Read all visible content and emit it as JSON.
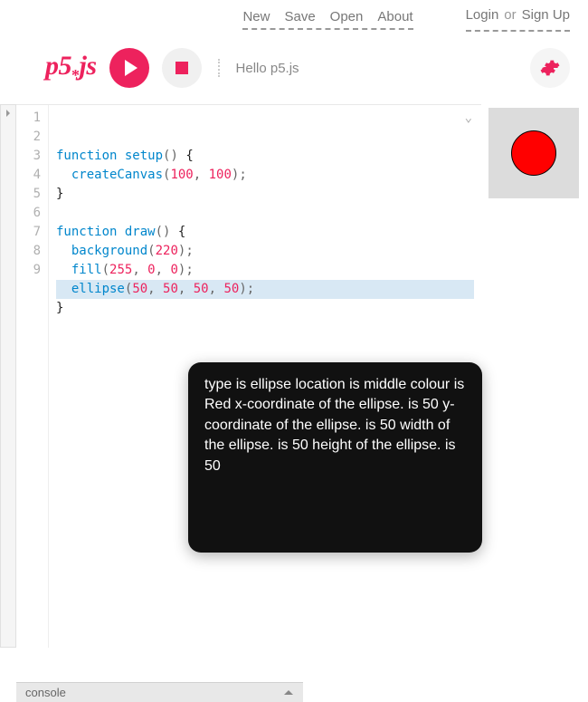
{
  "nav": {
    "new": "New",
    "save": "Save",
    "open": "Open",
    "about": "About",
    "login": "Login",
    "or": "or",
    "signup": "Sign Up"
  },
  "logo": {
    "prefix": "p5",
    "star": "*",
    "suffix": "js"
  },
  "sketch_name": "Hello p5.js",
  "code": {
    "lines": [
      1,
      2,
      3,
      4,
      5,
      6,
      7,
      8,
      9
    ],
    "l1_fn": "function",
    "l1_name": "setup",
    "l1_paren": "()",
    "l1_brace": " {",
    "l2_fn": "createCanvas",
    "l2_open": "(",
    "l2_a": "100",
    "l2_c": ", ",
    "l2_b": "100",
    "l2_close": ");",
    "l3": "}",
    "l5_fn": "function",
    "l5_name": "draw",
    "l5_paren": "()",
    "l5_brace": " {",
    "l6_fn": "background",
    "l6_open": "(",
    "l6_a": "220",
    "l6_close": ");",
    "l7_fn": "fill",
    "l7_open": "(",
    "l7_a": "255",
    "l7_c1": ", ",
    "l7_b": "0",
    "l7_c2": ", ",
    "l7_c": "0",
    "l7_close": ");",
    "l8_fn": "ellipse",
    "l8_open": "(",
    "l8_a": "50",
    "l8_c1": ", ",
    "l8_b": "50",
    "l8_c2": ", ",
    "l8_c": "50",
    "l8_c3": ", ",
    "l8_d": "50",
    "l8_close": ");",
    "l9": "}"
  },
  "tooltip": "type is ellipse location is middle colour is Red x-coordinate of the ellipse. is 50 y-coordinate of the ellipse. is 50 width of the ellipse. is 50 height of the ellipse. is 50",
  "console_label": "console",
  "chevron": "⌄"
}
